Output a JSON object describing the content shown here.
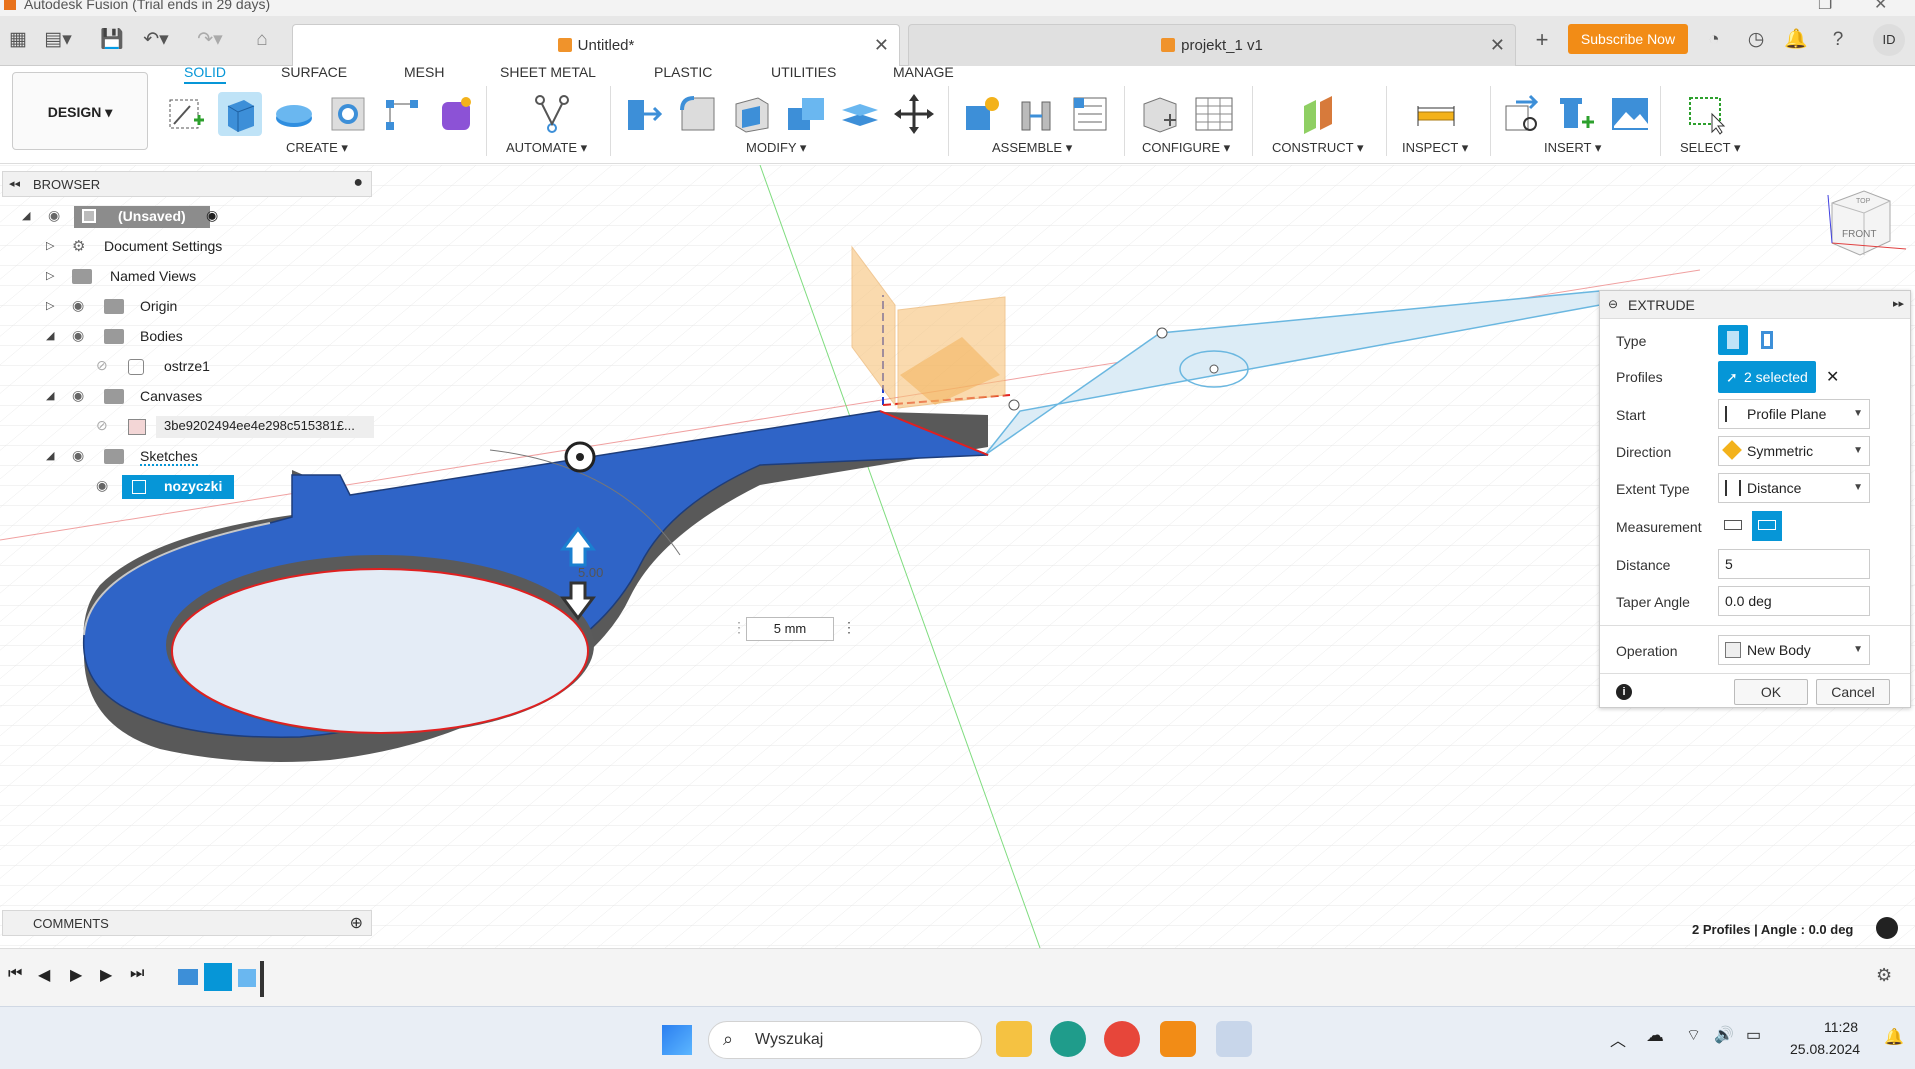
{
  "titlebar": {
    "title": "Autodesk Fusion (Trial ends in 29 days)"
  },
  "tabs": [
    {
      "label": "Untitled*",
      "active": true
    },
    {
      "label": "projekt_1 v1",
      "active": false
    }
  ],
  "header": {
    "subscribe_label": "Subscribe Now",
    "avatar_initials": "ID"
  },
  "ribbon": {
    "tabs": [
      "SOLID",
      "SURFACE",
      "MESH",
      "SHEET METAL",
      "PLASTIC",
      "UTILITIES",
      "MANAGE"
    ],
    "design_label": "DESIGN ▾",
    "groups": [
      "CREATE ▾",
      "AUTOMATE ▾",
      "MODIFY ▾",
      "ASSEMBLE ▾",
      "CONFIGURE ▾",
      "CONSTRUCT ▾",
      "INSPECT ▾",
      "INSERT ▾",
      "SELECT ▾"
    ]
  },
  "browser": {
    "title": "BROWSER",
    "root": "(Unsaved)",
    "items": [
      {
        "label": "Document Settings"
      },
      {
        "label": "Named Views"
      },
      {
        "label": "Origin"
      },
      {
        "label": "Bodies"
      },
      {
        "label": "ostrze1"
      },
      {
        "label": "Canvases"
      },
      {
        "label": "3be9202494ee4e298c515381£..."
      },
      {
        "label": "Sketches"
      },
      {
        "label": "nozyczki"
      }
    ]
  },
  "comments": {
    "title": "COMMENTS"
  },
  "viewcube": {
    "top": "TOP",
    "front": "FRONT"
  },
  "viewport": {
    "dimension_value": "5 mm",
    "distance_tag": "5.00"
  },
  "extrude": {
    "title": "EXTRUDE",
    "rows": {
      "type": "Type",
      "profiles": "Profiles",
      "profiles_value": "2 selected",
      "start": "Start",
      "start_value": "Profile Plane",
      "direction": "Direction",
      "direction_value": "Symmetric",
      "extent_type": "Extent Type",
      "extent_value": "Distance",
      "measurement": "Measurement",
      "distance": "Distance",
      "distance_value": "5",
      "taper": "Taper Angle",
      "taper_value": "0.0 deg",
      "operation": "Operation",
      "operation_value": "New Body"
    },
    "ok": "OK",
    "cancel": "Cancel"
  },
  "status": {
    "text": "2 Profiles | Angle : 0.0 deg"
  },
  "taskbar": {
    "search_placeholder": "Wyszukaj",
    "time": "11:28",
    "date": "25.08.2024"
  },
  "colors": {
    "accent": "#0696d7",
    "body": "#2f64c7",
    "subscribe": "#f28c16"
  }
}
